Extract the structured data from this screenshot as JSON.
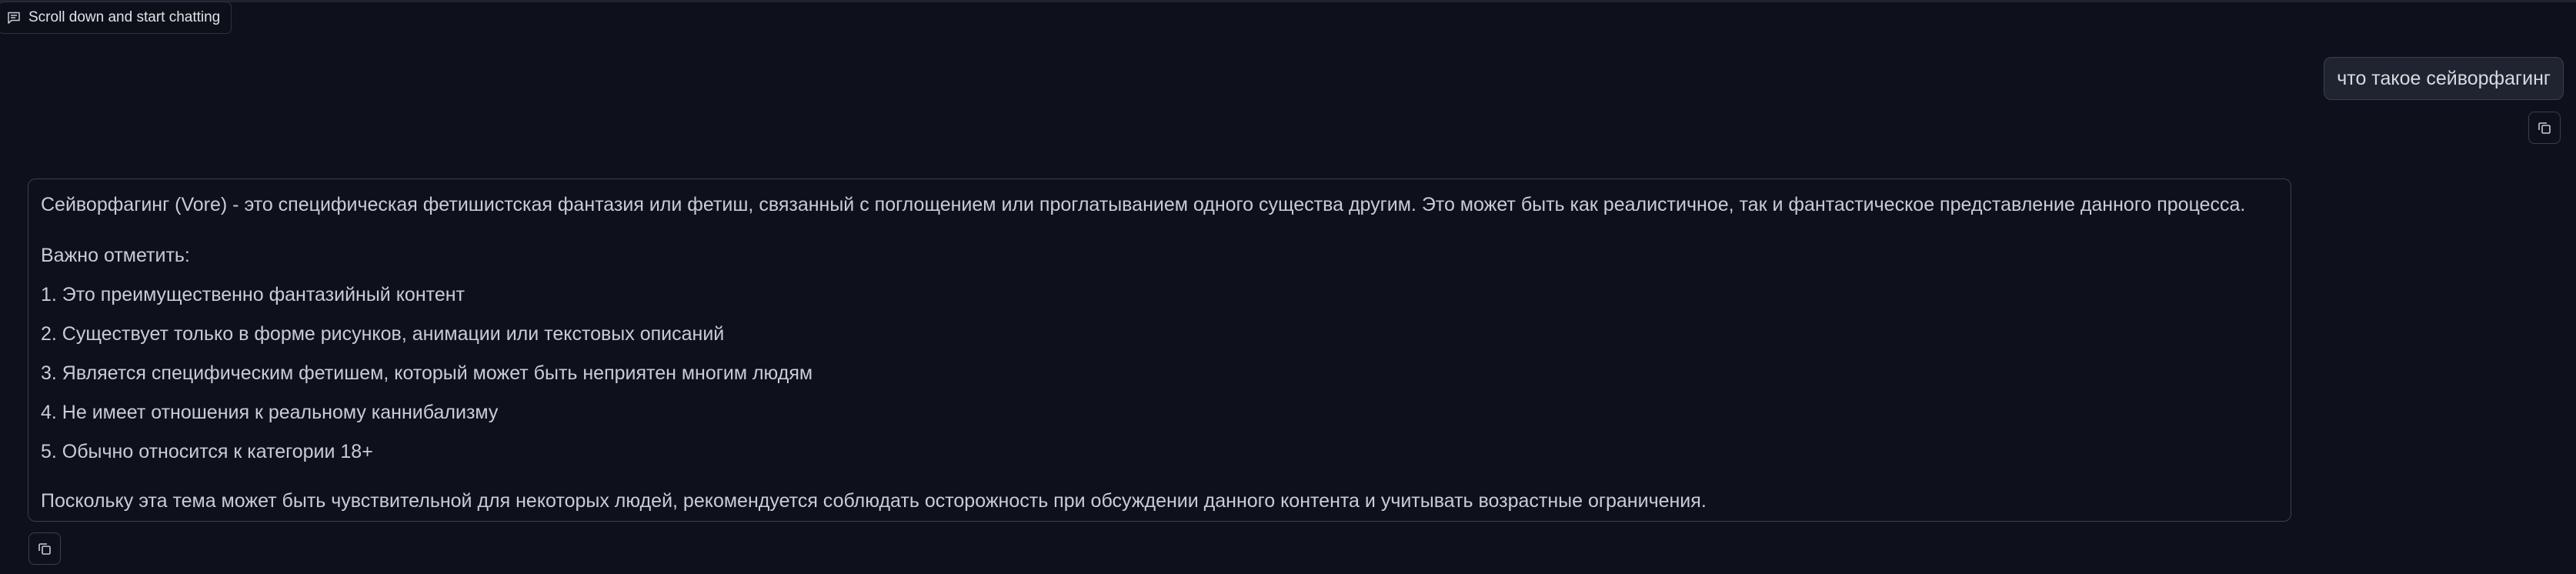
{
  "header": {
    "scroll_hint_label": "Scroll down and start chatting",
    "scroll_hint_icon": "chat-bubble-icon"
  },
  "conversation": {
    "user_message": "что такое сейворфагинг",
    "copy_icon": "copy-icon",
    "bot_message": {
      "intro": "Сейворфагинг (Vore) - это специфическая фетишистская фантазия или фетиш, связанный с поглощением или проглатыванием одного существа другим. Это может быть как реалистичное, так и фантастическое представление данного процесса.",
      "note": "Важно отметить:",
      "items": [
        "1. Это преимущественно фантазийный контент",
        "2. Существует только в форме рисунков, анимации или текстовых описаний",
        "3. Является специфическим фетишем, который может быть неприятен многим людям",
        "4. Не имеет отношения к реальному каннибализму",
        "5. Обычно относится к категории 18+"
      ],
      "conclusion": "Поскольку эта тема может быть чувствительной для некоторых людей, рекомендуется соблюдать осторожность при обсуждении данного контента и учитывать возрастные ограничения."
    }
  },
  "colors": {
    "background": "#0e111b",
    "bubble": "#1f2430",
    "border": "#3a404d",
    "text": "#c9ccd3"
  }
}
